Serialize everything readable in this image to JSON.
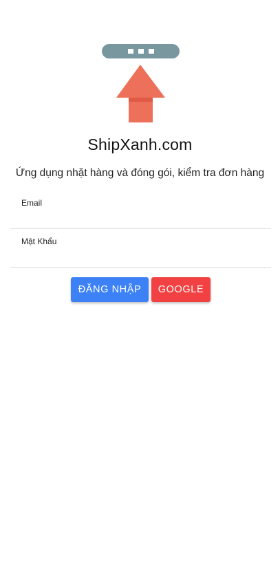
{
  "app": {
    "logo_icon": "up-arrow-logo-icon",
    "brand": "ShipXanh.com",
    "tagline": "Ứng dụng nhặt hàng và đóng gói, kiểm tra đơn hàng"
  },
  "form": {
    "email": {
      "label": "Email",
      "value": ""
    },
    "password": {
      "label": "Mật Khẩu",
      "value": ""
    }
  },
  "actions": {
    "login_label": "ĐĂNG NHẬP",
    "google_label": "GOOGLE"
  },
  "colors": {
    "logo_bar": "#78979f",
    "arrow": "#ec705a",
    "arrow_band": "#e05a45",
    "login": "#3c82f6",
    "google": "#f24142"
  }
}
